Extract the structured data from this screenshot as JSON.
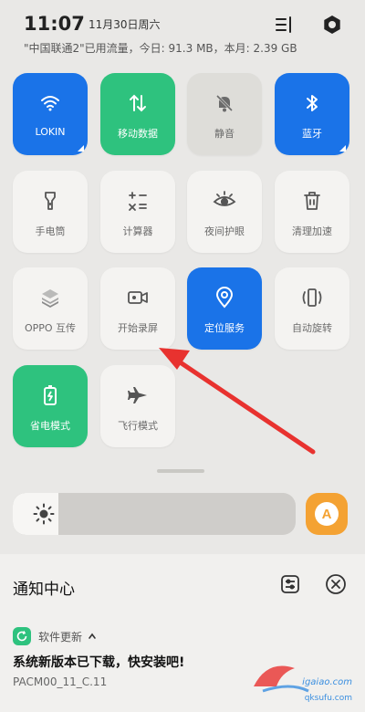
{
  "status_bar": {
    "time": "11:07",
    "date": "11月30日周六",
    "traffic": "\"中国联通2\"已用流量，今日: 91.3 MB，本月: 2.39 GB",
    "icons": [
      "edit-tiles-icon",
      "settings-icon"
    ]
  },
  "tiles": [
    {
      "label": "LOKIN",
      "icon": "wifi-icon",
      "state": "on",
      "color": "#1a73e8"
    },
    {
      "label": "移动数据",
      "icon": "mobile-data-icon",
      "state": "on",
      "color": "#2ec27e"
    },
    {
      "label": "静音",
      "icon": "mute-icon",
      "state": "off"
    },
    {
      "label": "蓝牙",
      "icon": "bluetooth-icon",
      "state": "on",
      "color": "#1a73e8"
    },
    {
      "label": "手电筒",
      "icon": "flashlight-icon",
      "state": "off"
    },
    {
      "label": "计算器",
      "icon": "calculator-icon",
      "state": "off"
    },
    {
      "label": "夜间护眼",
      "icon": "eye-icon",
      "state": "off"
    },
    {
      "label": "清理加速",
      "icon": "trash-icon",
      "state": "off"
    },
    {
      "label": "OPPO 互传",
      "icon": "oppo-share-icon",
      "state": "off"
    },
    {
      "label": "开始录屏",
      "icon": "screen-record-icon",
      "state": "off"
    },
    {
      "label": "定位服务",
      "icon": "location-icon",
      "state": "on",
      "color": "#1a73e8"
    },
    {
      "label": "自动旋转",
      "icon": "auto-rotate-icon",
      "state": "off"
    },
    {
      "label": "省电模式",
      "icon": "battery-saver-icon",
      "state": "on",
      "color": "#2ec27e"
    },
    {
      "label": "飞行模式",
      "icon": "airplane-icon",
      "state": "off"
    }
  ],
  "brightness": {
    "level": 0.16,
    "auto_label": "A",
    "accent": "#f4a233"
  },
  "notifications": {
    "title": "通知中心",
    "items": [
      {
        "app": "软件更新",
        "message": "系统新版本已下载，快安装吧!",
        "detail": "PACM00_11_C.11"
      }
    ]
  },
  "watermark": {
    "line1": "igaiao.com",
    "line2": "qksufu.com"
  }
}
